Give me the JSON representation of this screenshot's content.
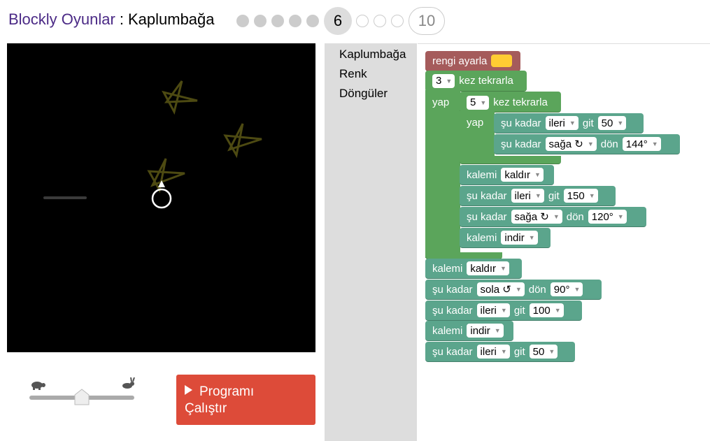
{
  "header": {
    "app_title": "Blockly Oyunlar",
    "separator": ":",
    "level_name": "Kaplumbağa",
    "current_level": "6",
    "last_level": "10"
  },
  "stage": {
    "background": "#000000",
    "star_color": "#4d4a12"
  },
  "controls": {
    "speed_slow_icon": "turtle-icon",
    "speed_fast_icon": "rabbit-icon",
    "speed_value": 0.5,
    "run_label_1": "Programı",
    "run_label_2": "Çalıştır"
  },
  "toolbox": {
    "categories": [
      "Kaplumbağa",
      "Renk",
      "Döngüler"
    ]
  },
  "blocks": {
    "set_color": "rengi ayarla",
    "repeat_label": "kez tekrarla",
    "do_label": "yap",
    "outer_repeat": "3",
    "inner_repeat": "5",
    "move_prefix": "şu kadar",
    "move_suffix": "git",
    "turn_suffix": "dön",
    "pen_label": "kalemi",
    "forward": "ileri",
    "right": "sağa ↻",
    "left": "sola ↺",
    "pen_up": "kaldır",
    "pen_down": "indir",
    "v50": "50",
    "v144": "144°",
    "v150": "150",
    "v120": "120°",
    "v90": "90°",
    "v100": "100",
    "v50b": "50"
  }
}
